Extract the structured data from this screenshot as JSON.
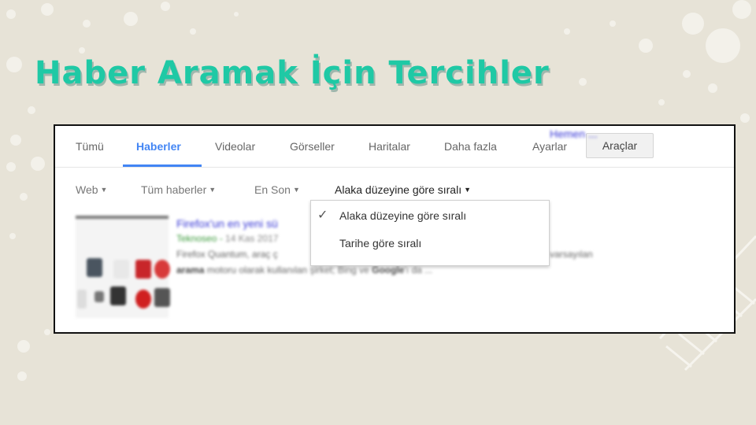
{
  "slide": {
    "title": "Haber Aramak İçin Tercihler"
  },
  "tabs": [
    {
      "label": "Tümü",
      "active": false
    },
    {
      "label": "Haberler",
      "active": true
    },
    {
      "label": "Videolar",
      "active": false
    },
    {
      "label": "Görseller",
      "active": false
    },
    {
      "label": "Haritalar",
      "active": false
    },
    {
      "label": "Daha fazla",
      "active": false
    },
    {
      "label": "Ayarlar",
      "active": false
    }
  ],
  "tools_button": {
    "label": "Araçlar"
  },
  "filters": [
    {
      "label": "Web"
    },
    {
      "label": "Tüm haberler"
    },
    {
      "label": "En Son"
    },
    {
      "label": "Alaka düzeyine göre sıralı",
      "selected": true
    }
  ],
  "sort_dropdown": {
    "options": [
      {
        "label": "Alaka düzeyine göre sıralı",
        "checked": true
      },
      {
        "label": "Tarihe göre sıralı",
        "checked": false
      }
    ]
  },
  "result": {
    "title": "Firefox'un en yeni sü",
    "title_tail": "Hemen ...",
    "source": "Teknoseo",
    "date": "14 Kas 2017",
    "snippet_line1": "Firefox Quantum, araç ç",
    "snippet_line1_tail": "varsayılan",
    "snippet_line2_bold1": "arama",
    "snippet_line2_mid": " motoru olarak kullanılan şirket; Bing ve ",
    "snippet_line2_bold2": "Google",
    "snippet_line2_end": "'ı da ..."
  },
  "colors": {
    "background": "#e7e3d7",
    "title_teal": "#1fc9a5",
    "active_blue": "#4285f4",
    "link_blue": "#3b3bd6",
    "source_green": "#3a9a3a"
  }
}
